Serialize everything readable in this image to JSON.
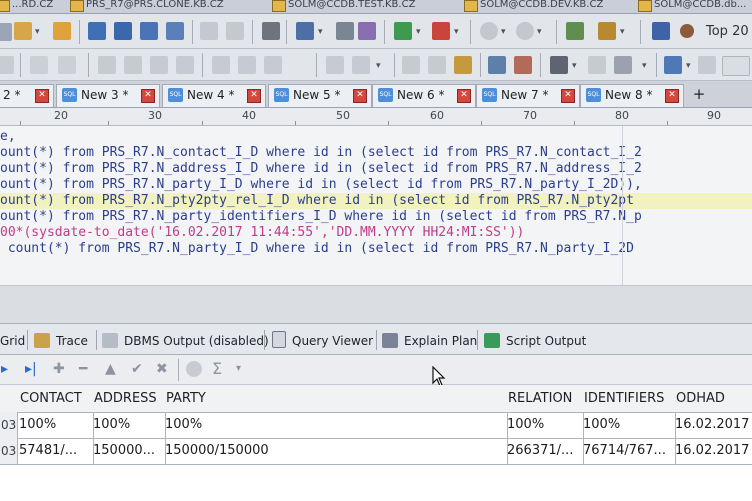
{
  "connection_tabs": [
    "...RD.CZ",
    "PRS_R7@PRS.CLONE.KB.CZ",
    "SOLM@CCDB.TEST.KB.CZ",
    "SOLM@CCDB.DEV.KB.CZ",
    "SOLM@CCDB.db..."
  ],
  "toolbar": {
    "fetch_rows_label": "Top 20",
    "dropdown_glyph": "▾"
  },
  "editor_tabs": {
    "tabs": [
      {
        "label": "2 *"
      },
      {
        "label": "New 3 *"
      },
      {
        "label": "New 4 *"
      },
      {
        "label": "New 5 *"
      },
      {
        "label": "New 6 *"
      },
      {
        "label": "New 7 *"
      },
      {
        "label": "New 8 *"
      }
    ],
    "sql_icon_text": "SQL",
    "close_glyph": "✕",
    "add_glyph": "+"
  },
  "ruler": {
    "marks": [
      "20",
      "30",
      "40",
      "50",
      "60",
      "70",
      "80",
      "90"
    ]
  },
  "editor": {
    "lines": [
      "e,",
      "ount(*) from PRS_R7.N_contact_I_D where id in (select id from PRS_R7.N_contact_I_2",
      "ount(*) from PRS_R7.N_address_I_D where id in (select id from PRS_R7.N_address_I_2",
      "ount(*) from PRS_R7.N_party_I_D where id in (select id from PRS_R7.N_party_I_2D)),",
      "ount(*) from PRS_R7.N_pty2pty_rel_I_D where id in (select id from PRS_R7.N_pty2pt",
      "ount(*) from PRS_R7.N_party_identifiers_I_D where id in (select id from PRS_R7.N_p",
      "00*(sysdate-to_date('16.02.2017 11:44:55','DD.MM.YYYY HH24:MI:SS'))",
      " count(*) from PRS_R7.N_party_I_D where id in (select id from PRS_R7.N_party_I_2D"
    ],
    "highlighted_line": 4
  },
  "output_tabs": [
    {
      "label": "Grid"
    },
    {
      "label": "Trace"
    },
    {
      "label": "DBMS Output (disabled)"
    },
    {
      "label": "Query Viewer"
    },
    {
      "label": "Explain Plan"
    },
    {
      "label": "Script Output"
    }
  ],
  "grid_toolbar": {
    "next_glyph": "▸",
    "last_glyph": "▸|",
    "add_glyph": "✚",
    "remove_glyph": "━",
    "up_glyph": "▲",
    "post_glyph": "✔",
    "cancel_glyph": "✖",
    "sum_glyph": "Σ",
    "menu_glyph": "▾"
  },
  "grid": {
    "columns": [
      "CONTACT",
      "ADDRESS",
      "PARTY",
      "RELATION",
      "IDENTIFIERS",
      "ODHAD"
    ],
    "rows": [
      {
        "rownum": "03",
        "cells": [
          "100%",
          "100%",
          "100%",
          "100%",
          "100%",
          "16.02.2017"
        ]
      },
      {
        "rownum": "03",
        "cells": [
          "57481/...",
          "150000...",
          "150000/150000",
          "266371/...",
          "76714/767...",
          "16.02.2017"
        ]
      }
    ]
  },
  "colors": {
    "keyword": "#2c3e8c",
    "string": "#c23b8a",
    "highlight_line": "#f1f2c0",
    "close_button": "#d4473e"
  }
}
